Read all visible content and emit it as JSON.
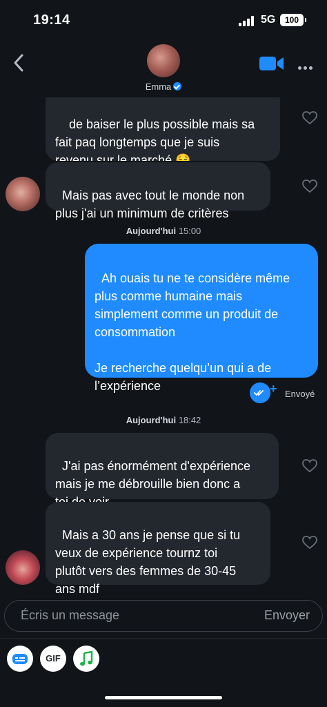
{
  "status_bar": {
    "time": "19:14",
    "network": "5G",
    "battery": "100"
  },
  "header": {
    "contact_name": "Emma"
  },
  "messages": [
    {
      "text": "de baiser le plus possible mais sa\nfait paq longtemps que je suis\nrevenu sur le marché 😌"
    },
    {
      "text": "Mais pas avec tout le monde non\nplus j'ai un minimum de critères"
    },
    {
      "text": "Ah ouais tu ne te considère même\nplus comme humaine mais\nsimplement comme un produit de\nconsommation\n\nJe recherche quelqu’un qui a de\nl’expérience"
    },
    {
      "text": "J'ai pas énormément d'expérience\nmais je me débrouille bien donc a\ntoi de voir"
    },
    {
      "text": "Mais a 30 ans je pense que si tu\nveux de expérience tournz toi\nplutôt vers des femmes de 30-45\nans mdf"
    }
  ],
  "dates": [
    {
      "label": "Aujourd'hui",
      "time": "15:00"
    },
    {
      "label": "Aujourd'hui",
      "time": "18:42"
    }
  ],
  "sent_status": "Envoyé",
  "composer": {
    "placeholder": "Écris un message",
    "send_label": "Envoyer"
  },
  "toolbar": {
    "gif_label": "GIF",
    "icons": [
      "sticker-icon",
      "gif-icon",
      "music-icon"
    ]
  },
  "colors": {
    "accent": "#1f8bff",
    "background": "#111418",
    "bubble_in": "#23272e"
  }
}
